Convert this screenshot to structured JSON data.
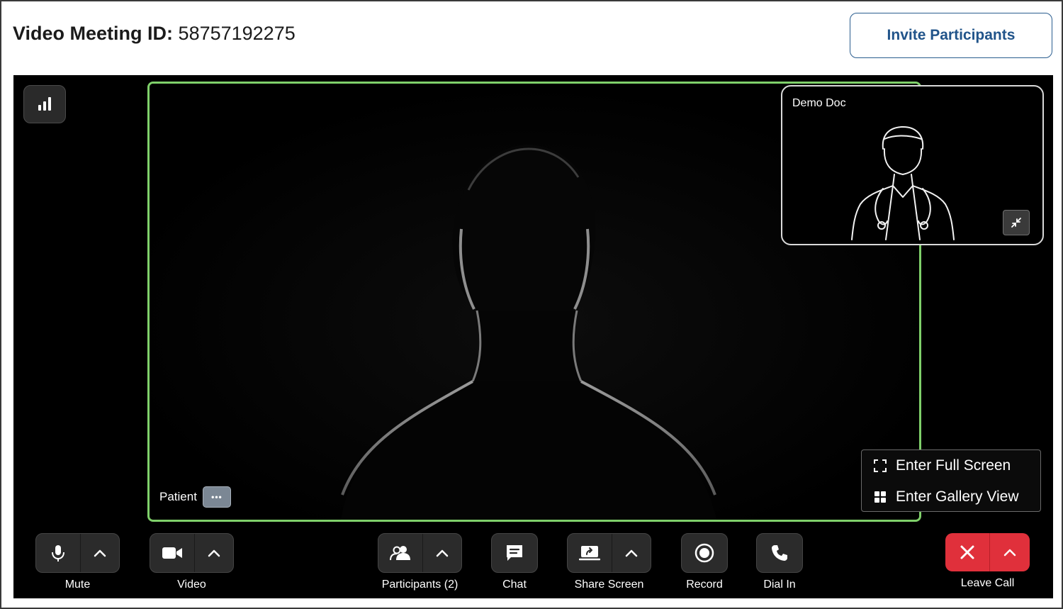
{
  "header": {
    "title_label": "Video Meeting ID:",
    "meeting_id": "58757192275",
    "invite_label": "Invite Participants"
  },
  "main_video": {
    "participant_name": "Patient",
    "more_label": "•••"
  },
  "pip": {
    "participant_name": "Demo Doc"
  },
  "view_menu": {
    "full_screen_label": "Enter Full Screen",
    "gallery_view_label": "Enter Gallery View"
  },
  "controls": {
    "mute_label": "Mute",
    "video_label": "Video",
    "participants_label": "Participants (2)",
    "chat_label": "Chat",
    "share_label": "Share Screen",
    "record_label": "Record",
    "dial_label": "Dial In",
    "leave_label": "Leave Call"
  },
  "colors": {
    "active_speaker_border": "#7fd06a",
    "leave_red": "#e0303b",
    "invite_blue": "#21548a"
  }
}
